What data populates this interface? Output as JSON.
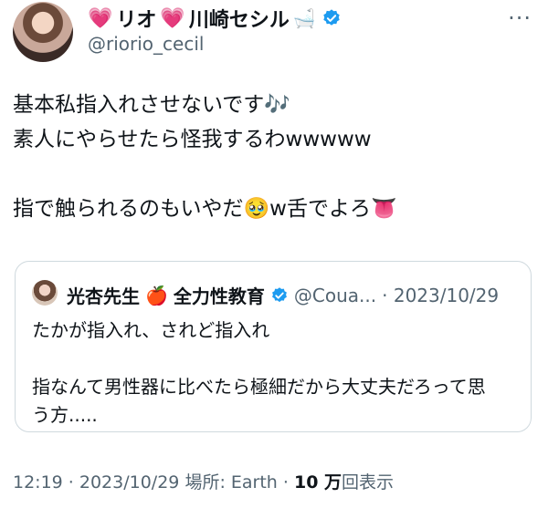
{
  "author": {
    "heart1": "💗",
    "name_part1": "リオ",
    "heart2": "💗",
    "name_part2": "川崎セシル",
    "bath_emoji": "🛁",
    "handle": "@riorio_cecil",
    "verified_icon": "verified-badge-icon"
  },
  "more_label": "···",
  "tweet_lines": [
    "基本私指入れさせないです🎶",
    "素人にやらせたら怪我するわwwwww",
    "",
    "指で触られるのもいやだ🥹w舌でよろ👅"
  ],
  "quote": {
    "name_part1": "光杏先生",
    "apple_emoji": "🍎",
    "name_part2": "全力性教育",
    "handle": "@Coua...",
    "date": "· 2023/10/29",
    "lines": [
      "たかが指入れ、されど指入れ",
      "",
      "指なんて男性器に比べたら極細だから大丈夫だろって思",
      "う方....."
    ]
  },
  "footer": {
    "time_date": "12:19 · 2023/10/29",
    "location": "場所: Earth ·",
    "views_count": "10 万",
    "views_label": "回表示"
  },
  "colors": {
    "accent_blue": "#1d9bf0",
    "text": "#0f1419",
    "muted": "#536471",
    "border": "#cfd9de"
  }
}
